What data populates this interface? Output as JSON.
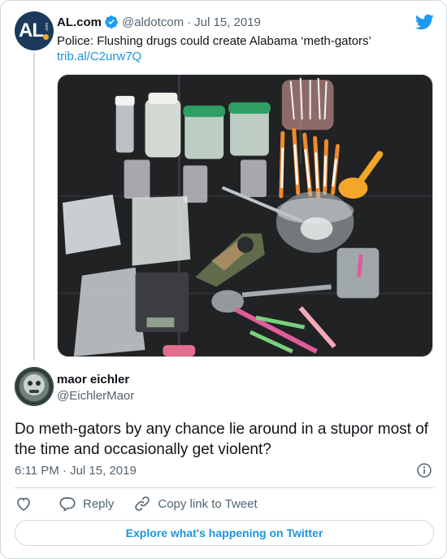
{
  "quoted": {
    "avatar_text": "AL",
    "avatar_subtext": ".com",
    "name": "AL.com",
    "handle": "@aldotcom",
    "separator": "·",
    "date": "Jul 15, 2019",
    "text": "Police: Flushing drugs could create Alabama ‘meth-gators’",
    "link": "trib.al/C2urw7Q"
  },
  "reply": {
    "name": "maor eichler",
    "handle": "@EichlerMaor",
    "text": "Do meth-gators by any chance lie around in a stupor most of the time and occasionally get violent?",
    "timestamp": "6:11 PM · Jul 15, 2019"
  },
  "actions": {
    "reply_label": "Reply",
    "copy_label": "Copy link to Tweet"
  },
  "explore_label": "Explore what's happening on Twitter",
  "colors": {
    "link": "#1b95e0",
    "twitter_blue": "#1d9bf0",
    "muted": "#536471",
    "border": "#cfd9de",
    "like_icon": "#536471"
  },
  "icons": [
    "verified-icon",
    "twitter-bird-icon",
    "info-icon",
    "heart-icon",
    "reply-icon",
    "link-icon"
  ]
}
